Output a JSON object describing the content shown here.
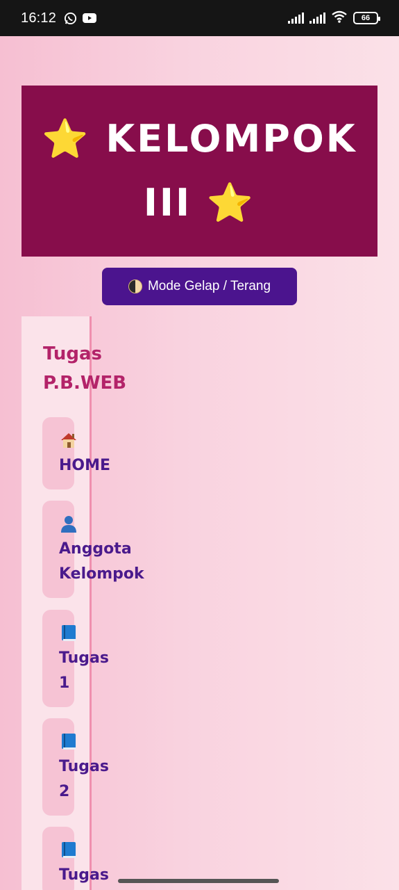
{
  "status_bar": {
    "time": "16:12",
    "battery": "66",
    "icons": [
      "whatsapp-icon",
      "youtube-icon",
      "signal-icon",
      "signal-icon",
      "wifi-icon",
      "battery-icon"
    ]
  },
  "banner": {
    "title_line1": "⭐ KELOMPOK",
    "title_line2": "III ⭐",
    "background": "#870d4b"
  },
  "mode_button": {
    "label": "Mode Gelap / Terang",
    "icon": "half-moon-icon",
    "background": "#4b148e"
  },
  "sidebar": {
    "title": "Tugas P.B.WEB",
    "items": [
      {
        "icon": "house-icon",
        "label": "HOME"
      },
      {
        "icon": "person-icon",
        "label": "Anggota Kelompok"
      },
      {
        "icon": "book-icon",
        "label": "Tugas 1"
      },
      {
        "icon": "book-icon",
        "label": "Tugas 2"
      },
      {
        "icon": "book-icon",
        "label": "Tugas"
      }
    ],
    "accent": "#b32369",
    "link_color": "#4a1a8c"
  }
}
